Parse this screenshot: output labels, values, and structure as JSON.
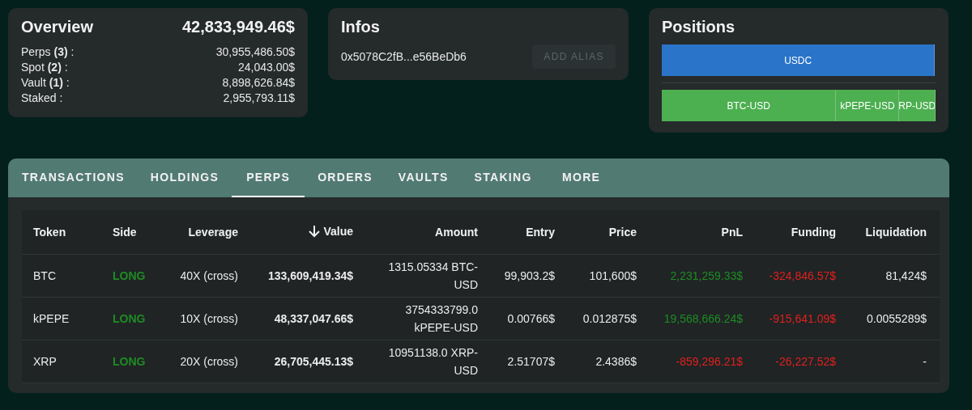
{
  "overview": {
    "title": "Overview",
    "total": "42,833,949.46$",
    "lines": [
      {
        "label": "Perps **(3)** :",
        "value": "30,955,486.50$"
      },
      {
        "label": "Spot **(2)** :",
        "value": "24,043.00$"
      },
      {
        "label": "Vault **(1)** :",
        "value": "8,898,626.84$"
      },
      {
        "label": "Staked :",
        "value": "2,955,793.11$"
      }
    ]
  },
  "infos": {
    "title": "Infos",
    "address": "0x5078C2fB...e56BeDb6",
    "button": "ADD ALIAS"
  },
  "positions": {
    "title": "Positions",
    "rows": [
      {
        "kind": "spot",
        "segments": [
          {
            "label": "USDC"
          }
        ]
      },
      {
        "kind": "perp",
        "segments": [
          {
            "label": "BTC-USD"
          },
          {
            "label": "kPEPE-USD"
          },
          {
            "label": "RP-USD"
          }
        ]
      }
    ]
  },
  "tabs": [
    {
      "label": "TRANSACTIONS",
      "selected": false
    },
    {
      "label": "HOLDINGS",
      "selected": false
    },
    {
      "label": "PERPS",
      "selected": true
    },
    {
      "label": "ORDERS",
      "selected": false
    },
    {
      "label": "VAULTS",
      "selected": false
    },
    {
      "label": "STAKING",
      "selected": false
    },
    {
      "label": "MORE",
      "selected": false
    }
  ],
  "table": {
    "columns": [
      {
        "label": "Token",
        "sorted": false
      },
      {
        "label": "Side",
        "sorted": false
      },
      {
        "label": "Leverage",
        "sorted": false
      },
      {
        "label": "Value",
        "sorted": true
      },
      {
        "label": "Amount",
        "sorted": false
      },
      {
        "label": "Entry",
        "sorted": false
      },
      {
        "label": "Price",
        "sorted": false
      },
      {
        "label": "PnL",
        "sorted": false
      },
      {
        "label": "Funding",
        "sorted": false
      },
      {
        "label": "Liquidation",
        "sorted": false
      }
    ],
    "rows": [
      {
        "token": "BTC",
        "side": {
          "text": "LONG",
          "long": true
        },
        "leverage": "40X (cross)",
        "value": "133,609,419.34$",
        "amount": "1315.05334 BTC-USD",
        "entry": "99,903.2$",
        "price": "101,600$",
        "pnl": {
          "text": "2,231,259.33$",
          "positive": true
        },
        "funding": {
          "text": "-324,846.57$",
          "positive": false
        },
        "liquidation": "81,424$"
      },
      {
        "token": "kPEPE",
        "side": {
          "text": "LONG",
          "long": true
        },
        "leverage": "10X (cross)",
        "value": "48,337,047.66$",
        "amount": "3754333799.0 kPEPE-USD",
        "entry": "0.00766$",
        "price": "0.012875$",
        "pnl": {
          "text": "19,568,666.24$",
          "positive": true
        },
        "funding": {
          "text": "-915,641.09$",
          "positive": false
        },
        "liquidation": "0.0055289$"
      },
      {
        "token": "XRP",
        "side": {
          "text": "LONG",
          "long": true
        },
        "leverage": "20X (cross)",
        "value": "26,705,445.13$",
        "amount": "10951138.0 XRP-USD",
        "entry": "2.51707$",
        "price": "2.4386$",
        "pnl": {
          "text": "-859,296.21$",
          "positive": false
        },
        "funding": {
          "text": "-26,227.52$",
          "positive": false
        },
        "liquidation": "-"
      }
    ]
  }
}
